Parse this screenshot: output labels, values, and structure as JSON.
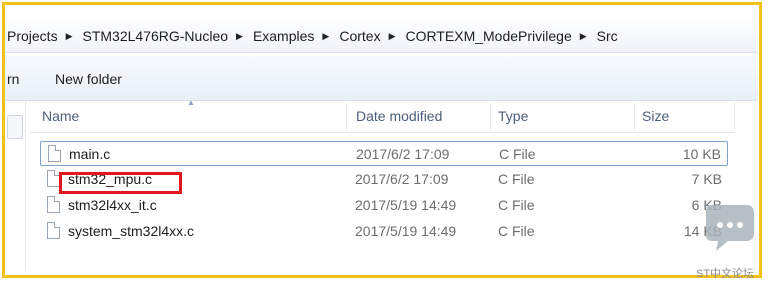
{
  "breadcrumb": {
    "items": [
      "Projects",
      "STM32L476RG-Nucleo",
      "Examples",
      "Cortex",
      "CORTEXM_ModePrivilege",
      "Src"
    ]
  },
  "toolbar": {
    "left_partial": "rn",
    "new_folder": "New folder"
  },
  "columns": {
    "name": "Name",
    "date": "Date modified",
    "type": "Type",
    "size": "Size"
  },
  "files": [
    {
      "name": "main.c",
      "date": "2017/6/2 17:09",
      "type": "C File",
      "size": "10 KB"
    },
    {
      "name": "stm32_mpu.c",
      "date": "2017/6/2 17:09",
      "type": "C File",
      "size": "7 KB"
    },
    {
      "name": "stm32l4xx_it.c",
      "date": "2017/5/19 14:49",
      "type": "C File",
      "size": "6 KB"
    },
    {
      "name": "system_stm32l4xx.c",
      "date": "2017/5/19 14:49",
      "type": "C File",
      "size": "14 KB"
    }
  ],
  "watermark": {
    "text": "ST中文论坛"
  },
  "colors": {
    "frame_border": "#f2c21b",
    "highlight_box": "#e5161c",
    "selected_row_border": "#7da2ce"
  }
}
